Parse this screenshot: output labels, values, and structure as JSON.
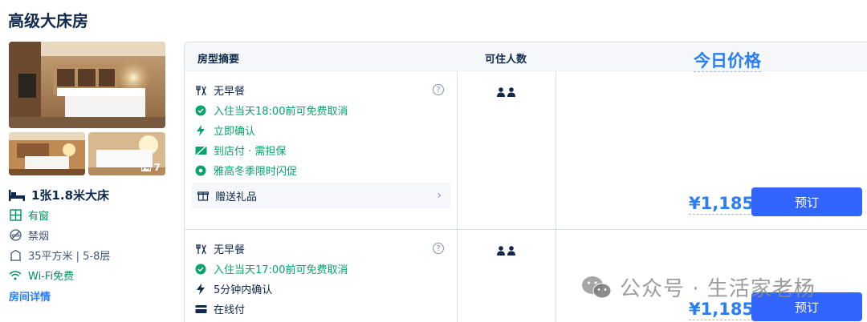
{
  "room": {
    "title": "高级大床房",
    "photo_count": "7",
    "bed": "1张1.8米大床",
    "facts": [
      {
        "icon": "window-icon",
        "text": "有窗",
        "green": true
      },
      {
        "icon": "no-smoking-icon",
        "text": "禁烟",
        "green": false
      },
      {
        "icon": "area-icon",
        "text": "35平方米 | 5-8层",
        "green": false
      },
      {
        "icon": "wifi-icon",
        "text": "Wi-Fi免费",
        "green": true
      }
    ],
    "detail_link": "房间详情"
  },
  "table": {
    "headers": {
      "summary": "房型摘要",
      "occupancy": "可住人数",
      "price": "今日价格"
    },
    "rows": [
      {
        "items": [
          {
            "icon": "utensils-icon",
            "text": "无早餐",
            "green": false
          },
          {
            "icon": "check-circle-icon",
            "text": "入住当天18:00前可免费取消",
            "green": true
          },
          {
            "icon": "lightning-icon",
            "text": "立即确认",
            "green": true
          },
          {
            "icon": "card-strike-icon",
            "text": "到店付 · 需担保",
            "green": true
          },
          {
            "icon": "promo-dot-icon",
            "text": "雅高冬季限时闪促",
            "green": true
          }
        ],
        "gift": "赠送礼品",
        "occupants": 2,
        "price": "¥1,185",
        "book_label": "预订"
      },
      {
        "items": [
          {
            "icon": "utensils-icon",
            "text": "无早餐",
            "green": false
          },
          {
            "icon": "check-circle-icon",
            "text": "入住当天17:00前可免费取消",
            "green": true
          },
          {
            "icon": "lightning-icon",
            "text": "5分钟内确认",
            "green": false
          },
          {
            "icon": "card-icon",
            "text": "在线付",
            "green": false
          }
        ],
        "occupants": 2,
        "price": "¥1,185",
        "book_label": "预订"
      }
    ]
  },
  "watermark": "公众号 · 生活家老杨",
  "colors": {
    "accent": "#287dfa",
    "button": "#3264ff",
    "green": "#06a36b",
    "text": "#0f294d"
  }
}
